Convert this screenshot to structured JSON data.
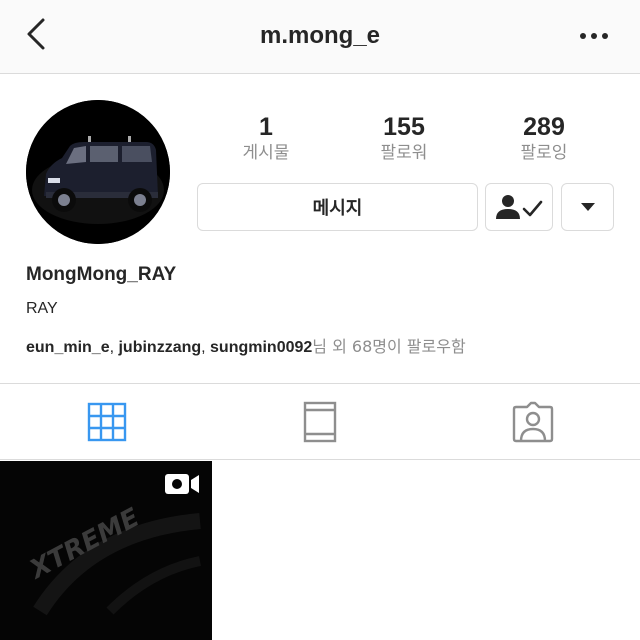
{
  "header": {
    "title": "m.mong_e",
    "back_icon": "chevron-left-icon",
    "more_icon": "more-horizontal-icon"
  },
  "profile": {
    "avatar": "profile-photo-dark-van",
    "stats": [
      {
        "value": "1",
        "label": "게시물"
      },
      {
        "value": "155",
        "label": "팔로워"
      },
      {
        "value": "289",
        "label": "팔로잉"
      }
    ],
    "message_label": "메시지",
    "following_icon": "person-check-icon",
    "dropdown_icon": "caret-down-icon",
    "display_name": "MongMong_RAY",
    "bio": "RAY",
    "followed_by": {
      "users": [
        "eun_min_e",
        "jubinzzang",
        "sungmin0092"
      ],
      "separator": ", ",
      "suffix": "님 외 68명이 팔로우함"
    }
  },
  "tabs": [
    {
      "name": "grid",
      "icon": "grid-icon",
      "active": true
    },
    {
      "name": "feed",
      "icon": "feed-icon",
      "active": false
    },
    {
      "name": "tagged",
      "icon": "tagged-person-icon",
      "active": false
    }
  ],
  "posts": [
    {
      "type": "video",
      "badge_icon": "video-camera-icon",
      "overlay_text": "XTREME"
    }
  ],
  "colors": {
    "accent_blue": "#3897f0",
    "text": "#262626",
    "muted": "#8e8e8e",
    "border": "#dbdbdb"
  }
}
